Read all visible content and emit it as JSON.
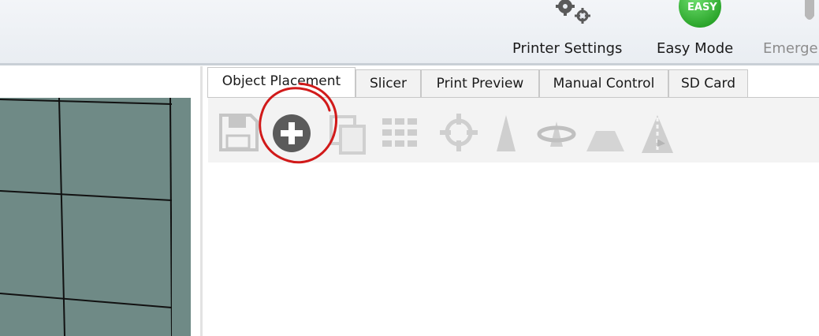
{
  "toolbar": {
    "printer_settings_label": "Printer Settings",
    "easy_mode_label": "Easy Mode",
    "easy_badge": "EASY",
    "emergency_label": "Emerge",
    "easy_badge_color": "#2db82d"
  },
  "tabs": [
    {
      "label": "Object Placement",
      "active": true
    },
    {
      "label": "Slicer",
      "active": false
    },
    {
      "label": "Print Preview",
      "active": false
    },
    {
      "label": "Manual Control",
      "active": false
    },
    {
      "label": "SD Card",
      "active": false
    }
  ],
  "object_tools": [
    {
      "icon": "save-icon",
      "enabled": false
    },
    {
      "icon": "add-object-icon",
      "enabled": true,
      "highlighted": true
    },
    {
      "icon": "copy-object-icon",
      "enabled": false
    },
    {
      "icon": "autoposition-grid-icon",
      "enabled": false
    },
    {
      "icon": "center-object-icon",
      "enabled": false
    },
    {
      "icon": "scale-object-icon",
      "enabled": false
    },
    {
      "icon": "rotate-object-icon",
      "enabled": false
    },
    {
      "icon": "cut-object-icon",
      "enabled": false
    },
    {
      "icon": "mirror-object-icon",
      "enabled": false
    }
  ],
  "colors": {
    "annotation_circle": "#d11a1a",
    "bed_surface": "#6f8a86",
    "bed_edge": "#8fb4c4"
  }
}
